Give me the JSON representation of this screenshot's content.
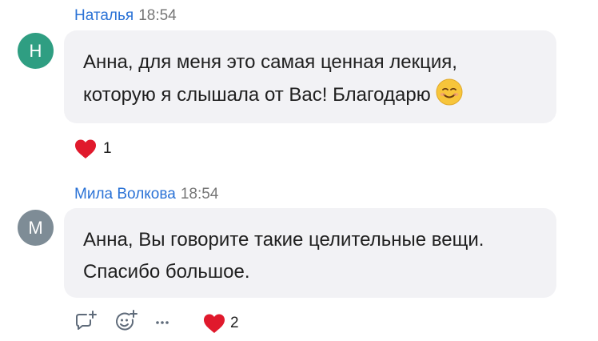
{
  "messages": [
    {
      "author": "Наталья",
      "time": "18:54",
      "avatar_letter": "Н",
      "avatar_color": "#2f9e82",
      "text": "Анна, для меня это самая ценная лекция, которую я слышала от Вас! Благодарю",
      "emoji": "smiling-face-icon",
      "reaction_icon": "heart-icon",
      "reaction_count": "1"
    },
    {
      "author": "Мила Волкова",
      "time": "18:54",
      "avatar_letter": "М",
      "avatar_color": "#7e8c96",
      "text": "Анна, Вы говорите такие целительные вещи. Спасибо большое.",
      "reaction_icon": "heart-icon",
      "reaction_count": "2",
      "actions": [
        "reply-icon",
        "add-reaction-icon",
        "more-icon"
      ]
    }
  ],
  "colors": {
    "author": "#2a72d6",
    "bubble": "#f2f2f5",
    "heart": "#e0192c"
  }
}
